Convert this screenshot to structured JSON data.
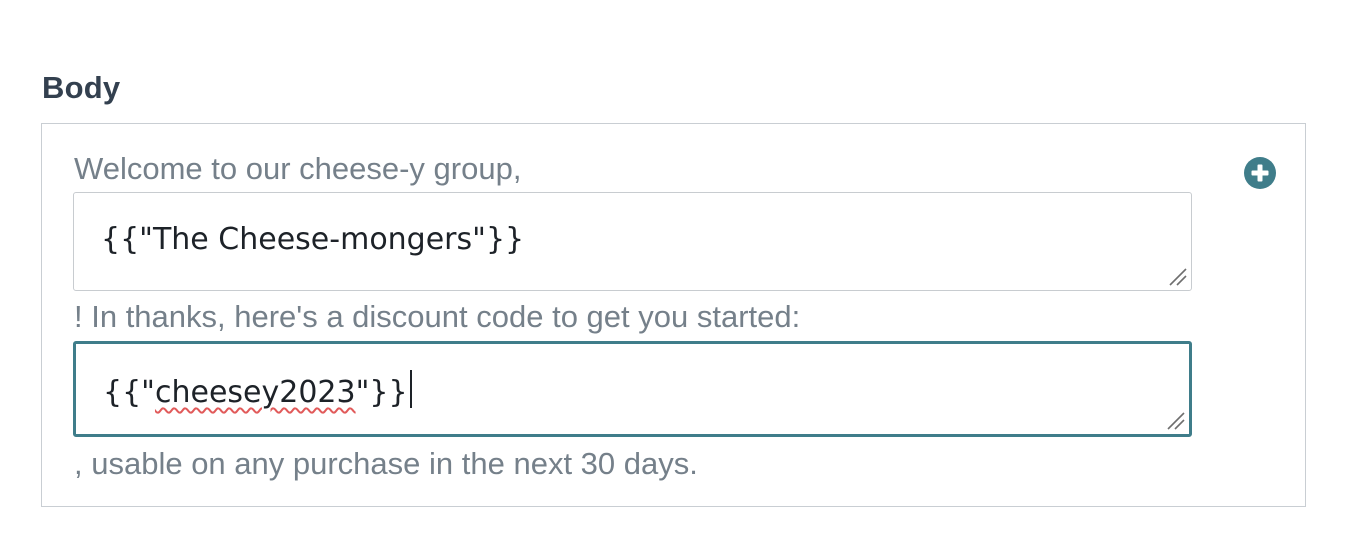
{
  "section": {
    "label": "Body"
  },
  "template": {
    "line1": "Welcome to our cheese-y group,",
    "field1": {
      "value": "{{\"The Cheese-mongers\"}}"
    },
    "line2": "! In thanks, here's a discount code to get you started:",
    "field2": {
      "prefix": "{{\"",
      "code": "cheesey2023",
      "suffix": "\"}}"
    },
    "line3": ", usable on any purchase in the next 30 days."
  },
  "icons": {
    "add": "plus-circle-icon",
    "resize": "resize-handle-icon"
  },
  "colors": {
    "accent": "#3f7d8a",
    "label": "#33404f",
    "static_text": "#75808a",
    "spellcheck": "#e15a5a"
  }
}
